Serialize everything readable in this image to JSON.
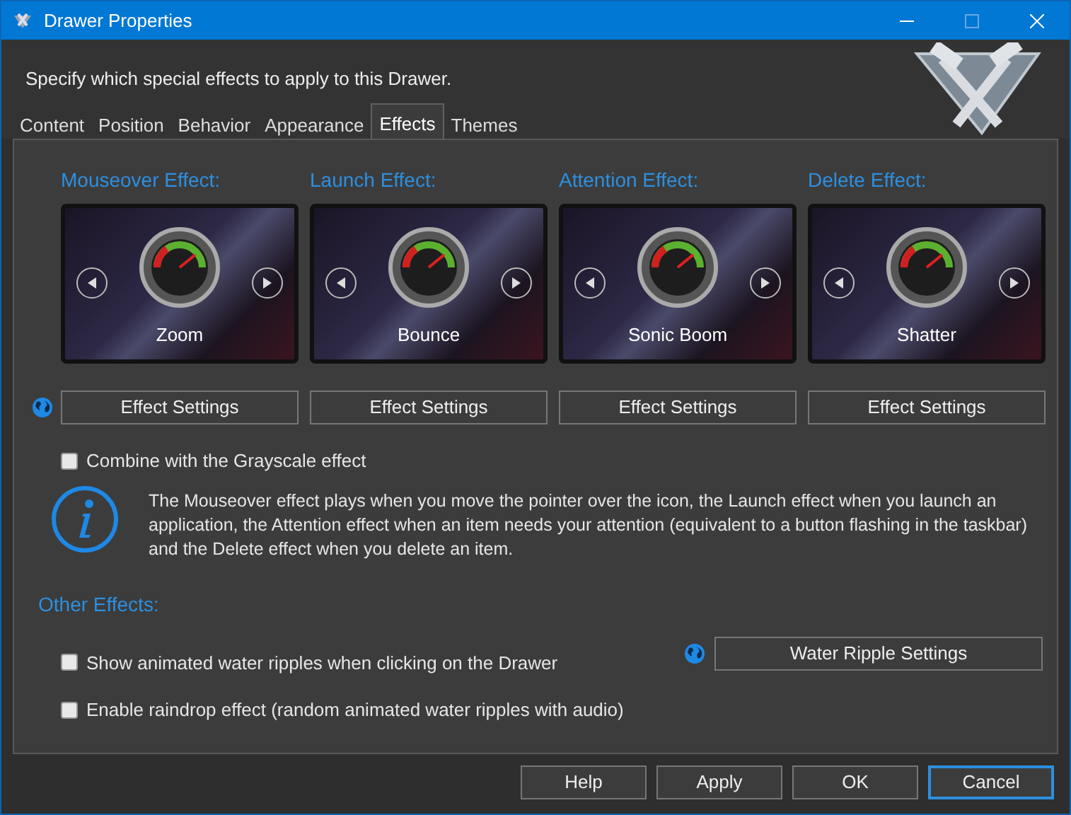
{
  "window": {
    "title": "Drawer Properties"
  },
  "header": {
    "subtitle": "Specify which special effects to apply to this Drawer."
  },
  "tabs": [
    {
      "label": "Content",
      "selected": false
    },
    {
      "label": "Position",
      "selected": false
    },
    {
      "label": "Behavior",
      "selected": false
    },
    {
      "label": "Appearance",
      "selected": false
    },
    {
      "label": "Effects",
      "selected": true
    },
    {
      "label": "Themes",
      "selected": false
    }
  ],
  "effects": [
    {
      "title": "Mouseover Effect:",
      "name": "Zoom",
      "button": "Effect Settings"
    },
    {
      "title": "Launch Effect:",
      "name": "Bounce",
      "button": "Effect Settings"
    },
    {
      "title": "Attention Effect:",
      "name": "Sonic Boom",
      "button": "Effect Settings"
    },
    {
      "title": "Delete Effect:",
      "name": "Shatter",
      "button": "Effect Settings"
    }
  ],
  "grayscale": {
    "label": "Combine with the Grayscale effect",
    "checked": false
  },
  "info": "The Mouseover effect plays when you move the pointer over the icon, the Launch effect when you launch an application, the Attention effect when an item needs your attention (equivalent to a button flashing in the taskbar) and the Delete effect when you delete an item.",
  "other_effects": {
    "title": "Other Effects:",
    "options": [
      {
        "label": "Show animated water ripples when clicking on the Drawer",
        "checked": false
      },
      {
        "label": "Enable raindrop effect (random animated water ripples with audio)",
        "checked": false
      }
    ],
    "button": "Water Ripple Settings"
  },
  "buttons": [
    {
      "label": "Help",
      "default": false
    },
    {
      "label": "Apply",
      "default": false
    },
    {
      "label": "OK",
      "default": false
    },
    {
      "label": "Cancel",
      "default": true
    }
  ]
}
